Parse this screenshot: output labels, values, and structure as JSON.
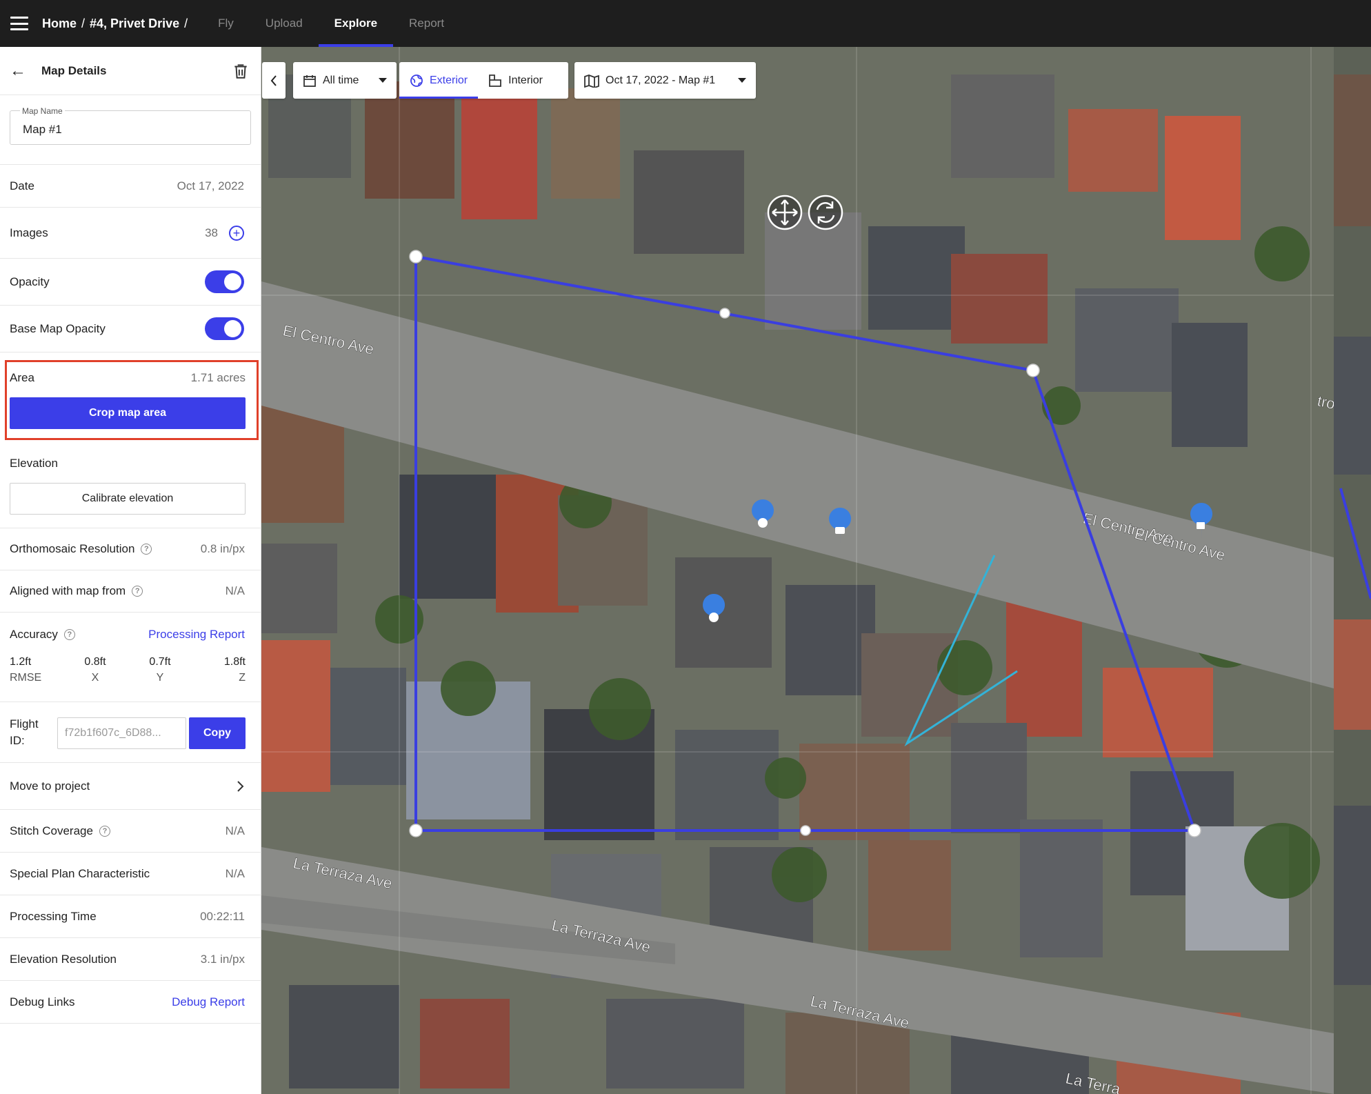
{
  "nav": {
    "breadcrumb": [
      "Home",
      "#4, Privet Drive"
    ],
    "tabs": [
      {
        "label": "Fly",
        "active": false
      },
      {
        "label": "Upload",
        "active": false
      },
      {
        "label": "Explore",
        "active": true
      },
      {
        "label": "Report",
        "active": false
      }
    ]
  },
  "sidebar": {
    "title": "Map Details",
    "map_name_label": "Map Name",
    "map_name_value": "Map #1",
    "date_label": "Date",
    "date_value": "Oct 17, 2022",
    "images_label": "Images",
    "images_value": "38",
    "opacity_label": "Opacity",
    "opacity_on": true,
    "base_opacity_label": "Base Map Opacity",
    "base_opacity_on": true,
    "area_label": "Area",
    "area_value": "1.71 acres",
    "crop_button": "Crop map area",
    "elevation_label": "Elevation",
    "calibrate_button": "Calibrate elevation",
    "ortho_label": "Orthomosaic Resolution",
    "ortho_value": "0.8 in/px",
    "aligned_label": "Aligned with map from",
    "aligned_value": "N/A",
    "accuracy_label": "Accuracy",
    "processing_report_link": "Processing Report",
    "accuracy": [
      {
        "value": "1.2ft",
        "key": "RMSE"
      },
      {
        "value": "0.8ft",
        "key": "X"
      },
      {
        "value": "0.7ft",
        "key": "Y"
      },
      {
        "value": "1.8ft",
        "key": "Z"
      }
    ],
    "flight_id_label": "Flight ID:",
    "flight_id_value": "f72b1f607c_6D88...",
    "copy_button": "Copy",
    "move_label": "Move to project",
    "stitch_label": "Stitch Coverage",
    "stitch_value": "N/A",
    "special_label": "Special Plan Characteristic",
    "special_value": "N/A",
    "proc_time_label": "Processing Time",
    "proc_time_value": "00:22:11",
    "elev_res_label": "Elevation Resolution",
    "elev_res_value": "3.1 in/px",
    "debug_label": "Debug Links",
    "debug_link": "Debug Report"
  },
  "map": {
    "time_filter": "All time",
    "view_exterior": "Exterior",
    "view_interior": "Interior",
    "active_view": "Exterior",
    "map_selector": "Oct 17, 2022 - Map #1",
    "street_labels": [
      "El Centro Ave",
      "El Centro Ave",
      "El Centro Ave",
      "tro Ave",
      "La Terraza Ave",
      "La Terraza Ave",
      "La Terraza Ave",
      "La Terra"
    ]
  },
  "colors": {
    "accent": "#3b3ee8",
    "highlight_border": "#e0402a",
    "topbar": "#1e1e1e",
    "crop_polygon": "#3a3ee0",
    "measure_line": "#33b3d8"
  }
}
